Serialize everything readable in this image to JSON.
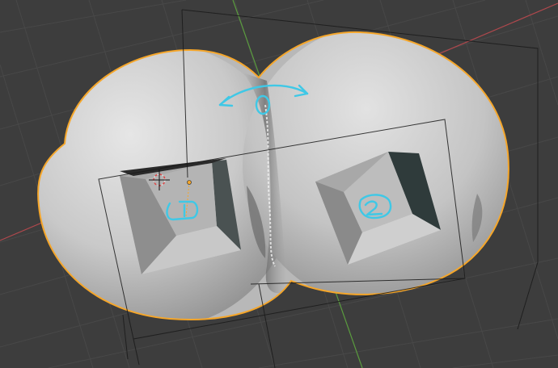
{
  "viewport": {
    "background": "#3d3d3d",
    "grid_color": "#484848",
    "x_axis_color": "#b0484d",
    "y_axis_color": "#5a9b3e",
    "selection_outline_color": "#f5a62a",
    "annotation_color": "#3fc8e6",
    "wireframe_color": "#1a1a1a"
  },
  "annotations": {
    "label_0": "0",
    "label_1": "1",
    "label_2": "2"
  },
  "icons": {
    "origin": "object-origin-icon",
    "cursor": "3d-cursor-icon"
  }
}
